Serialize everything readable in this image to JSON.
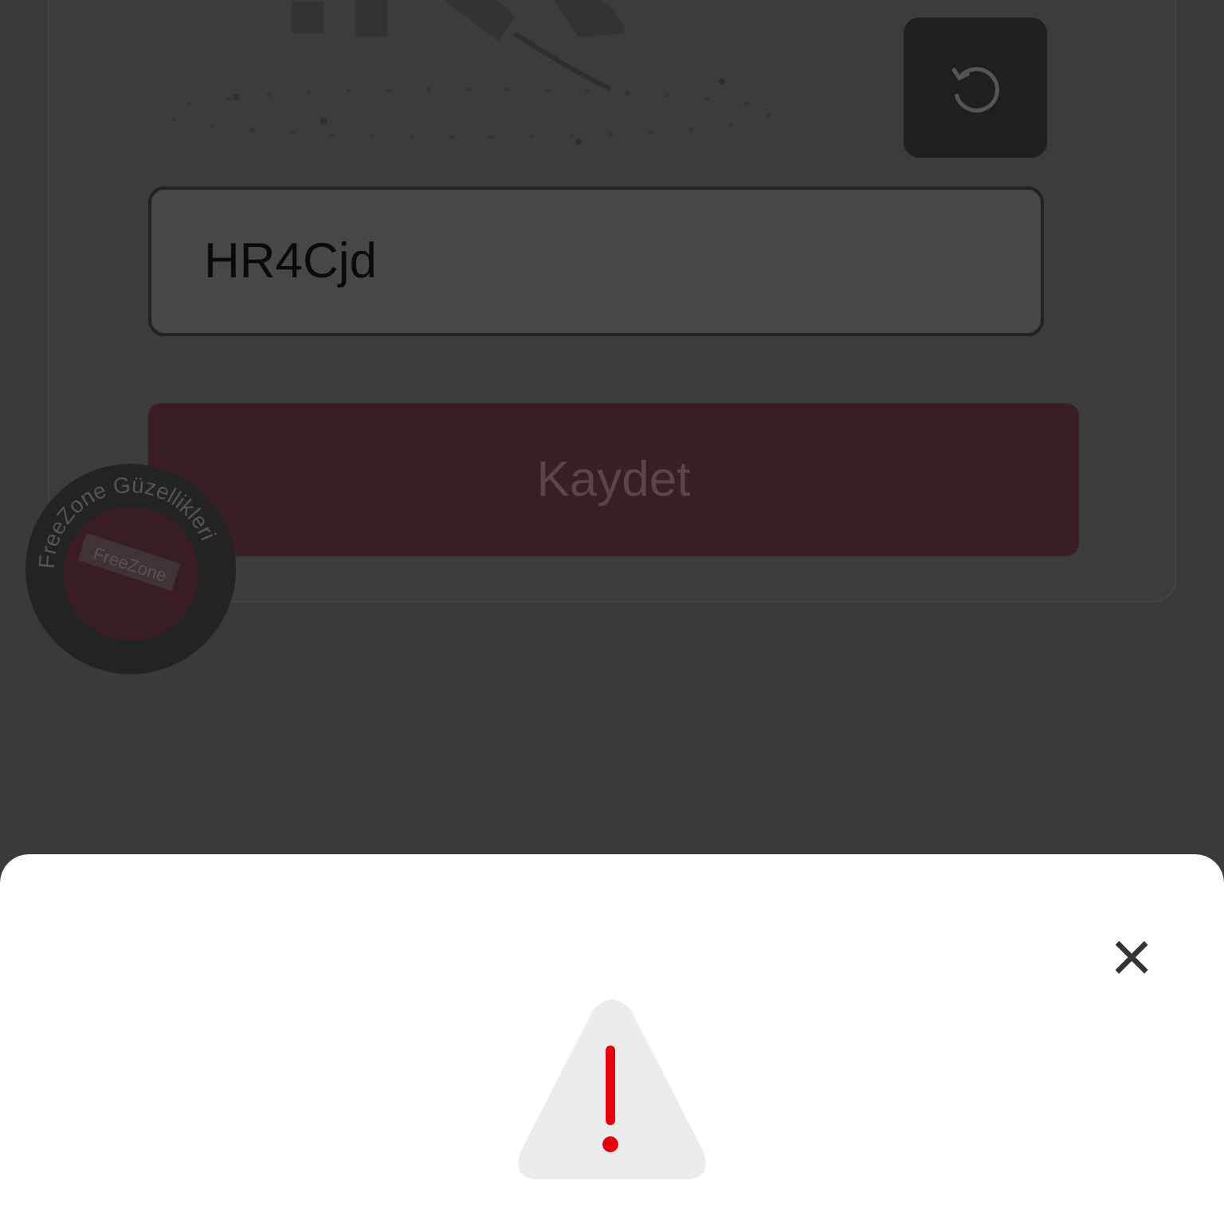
{
  "form": {
    "code_field": {
      "value": "HR4Cjd"
    },
    "submit_button": {
      "label": "Kaydet"
    }
  },
  "badge": {
    "ring_text": "FreeZone Güzellikleri",
    "center_text": "FreeZone"
  },
  "sheet": {
    "close": "×"
  }
}
